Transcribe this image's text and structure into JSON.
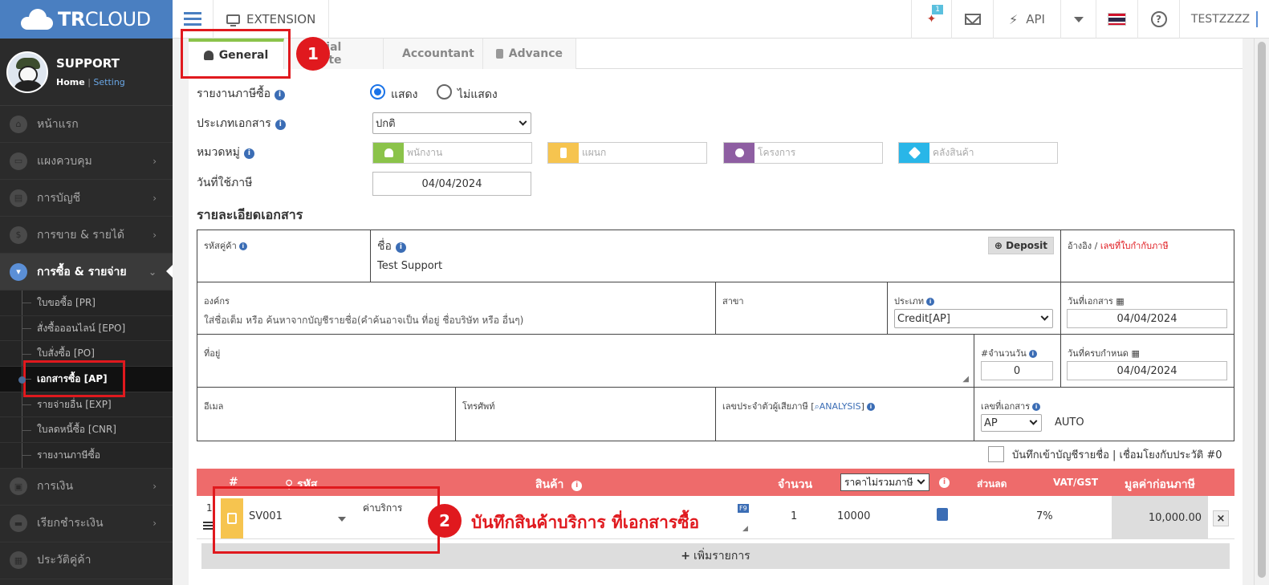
{
  "brand": {
    "name_bold": "TR",
    "name_rest": "CLOUD"
  },
  "profile": {
    "name": "SUPPORT",
    "home": "Home",
    "separator": "|",
    "setting": "Setting"
  },
  "nav": {
    "items": [
      {
        "label": "หน้าแรก",
        "icon": "home-icon",
        "chevron": false
      },
      {
        "label": "แผงควบคุม",
        "icon": "monitor-icon",
        "chevron": true
      },
      {
        "label": "การบัญชี",
        "icon": "book-icon",
        "chevron": true
      },
      {
        "label": "การขาย & รายได้",
        "icon": "dollar-icon",
        "chevron": true
      },
      {
        "label": "การซื้อ & รายจ่าย",
        "icon": "cart-icon",
        "chevron": true,
        "active": true
      }
    ],
    "sub_items": [
      {
        "label": "ใบขอซื้อ [PR]"
      },
      {
        "label": "สั่งซื้อออนไลน์ [EPO]"
      },
      {
        "label": "ใบสั่งซื้อ [PO]"
      },
      {
        "label": "เอกสารซื้อ [AP]",
        "active": true
      },
      {
        "label": "รายจ่ายอื่น [EXP]"
      },
      {
        "label": "ใบลดหนี้ซื้อ [CNR]"
      },
      {
        "label": "รายงานภาษีซื้อ"
      }
    ],
    "bottom_items": [
      {
        "label": "การเงิน",
        "icon": "wallet-icon",
        "chevron": true
      },
      {
        "label": "เรียกชำระเงิน",
        "icon": "card-icon",
        "chevron": true
      },
      {
        "label": "ประวัติคู่ค้า",
        "icon": "contact-icon",
        "chevron": false
      }
    ]
  },
  "topbar": {
    "extension_label": "EXTENSION",
    "notification_badge": "1",
    "api_label": "API",
    "user_label": "TESTZZZZ",
    "help_glyph": "?"
  },
  "tabs": [
    {
      "label": "General",
      "active": true
    },
    {
      "label": "ncial Note",
      "active": false
    },
    {
      "label": "Accountant",
      "active": false
    },
    {
      "label": "Advance",
      "active": false
    }
  ],
  "form": {
    "tax_report_label": "รายงานภาษีซื้อ",
    "radio_show": "แสดง",
    "radio_hide": "ไม่แสดง",
    "doc_type_label": "ประเภทเอกสาร",
    "doc_type_value": "ปกติ",
    "category_label": "หมวดหมู่",
    "category_employee": "พนักงาน",
    "category_department": "แผนก",
    "category_project": "โครงการ",
    "category_warehouse": "คลังสินค้า",
    "tax_date_label": "วันที่ใช้ภาษี",
    "tax_date_value": "04/04/2024"
  },
  "doc_details": {
    "section_title": "รายละเอียดเอกสาร",
    "customer_code_label": "รหัสคู่ค้า",
    "name_label": "ชื่อ",
    "name_value": "Test Support",
    "deposit_label": "Deposit",
    "ref_label": "อ้างอิง",
    "ref_slash": "/",
    "ref_tax_label": "เลขที่ใบกำกับภาษี",
    "org_label": "องค์กร",
    "org_placeholder": "ใส่ชื่อเต็ม หรือ ค้นหาจากบัญชีรายชื่อ(คำค้นอาจเป็น ที่อยู่ ชื่อบริษัท หรือ อื่นๆ)",
    "branch_label": "สาขา",
    "type_label": "ประเภท",
    "type_value": "Credit[AP]",
    "doc_date_label": "วันที่เอกสาร",
    "doc_date_value": "04/04/2024",
    "address_label": "ที่อยู่",
    "days_label": "#จำนวนวัน",
    "days_value": "0",
    "due_date_label": "วันที่ครบกำหนด",
    "due_date_value": "04/04/2024",
    "email_label": "อีเมล",
    "phone_label": "โทรศัพท์",
    "tax_id_label": "เลขประจำตัวผู้เสียภาษี [",
    "tax_id_analysis": "ANALYSIS",
    "tax_id_close": "]",
    "doc_no_label": "เลขที่เอกสาร",
    "doc_no_prefix": "AP",
    "doc_no_value": "AUTO",
    "bookmark_label": "บันทึกเข้าบัญชีรายชื่อ | เชื่อมโยงกับประวัติ #0"
  },
  "product_table": {
    "headers": {
      "num": "#",
      "code": "รหัส",
      "product": "สินค้า",
      "qty": "จำนวน",
      "price_type": "ราคาไม่รวมภาษี",
      "discount": "ส่วนลด",
      "vat": "VAT/GST",
      "net": "มูลค่าก่อนภาษี"
    },
    "rows": [
      {
        "num": "1",
        "code": "SV001",
        "description": "ค่าบริการ",
        "f9": "F9",
        "qty": "1",
        "price": "10000",
        "discount": "",
        "vat": "7%",
        "net": "10,000.00",
        "delete": "×"
      }
    ],
    "add_row_label": "เพิ่มรายการ",
    "add_row_glyph": "+"
  },
  "annotations": {
    "step1": "1",
    "step2": "2",
    "step2_text": "บันทึกสินค้าบริการ ที่เอกสารซื้อ"
  },
  "colors": {
    "brand_blue": "#4a7fc1",
    "accent_green": "#8bc34a",
    "table_header_red": "#ee6b6b",
    "annotation_red": "#e0191e",
    "employee_green": "#8bc34a",
    "department_yellow": "#f6c44f",
    "project_purple": "#8e5ea2",
    "warehouse_cyan": "#29b6e8"
  }
}
